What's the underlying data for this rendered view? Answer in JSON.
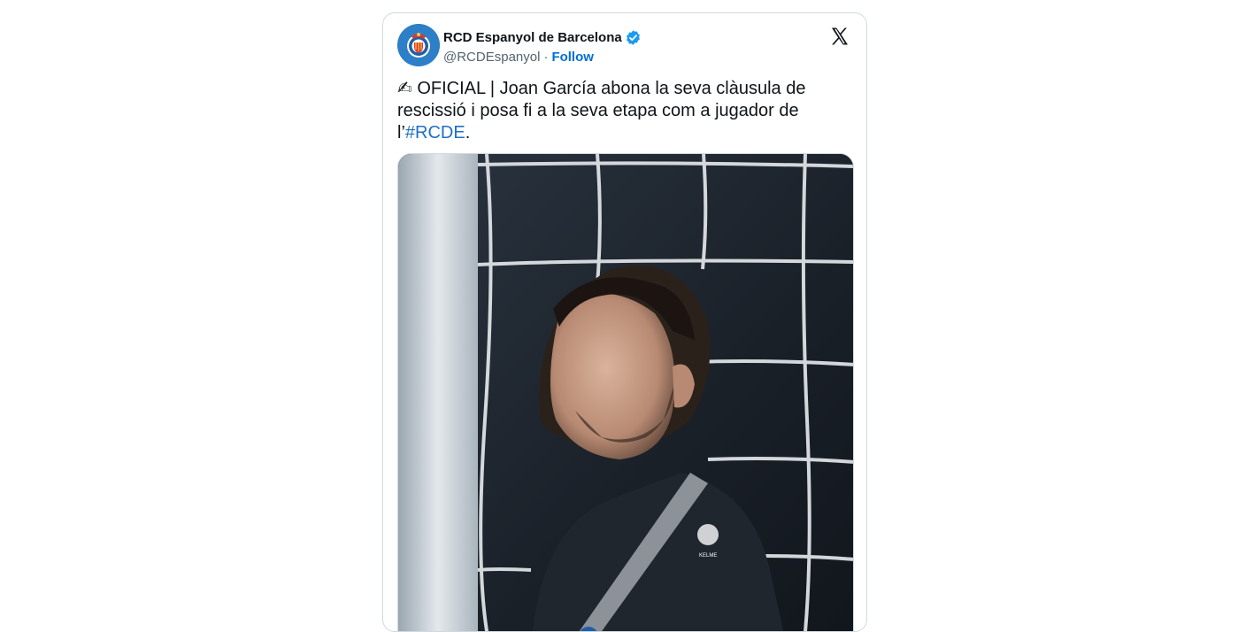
{
  "tweet": {
    "author": {
      "display_name": "RCD Espanyol de Barcelona",
      "handle": "@RCDEspanyol",
      "separator": "·",
      "follow_label": "Follow",
      "verified": true,
      "verified_color": "#1d9bf0"
    },
    "text": {
      "emoji": "✍",
      "body": " OFICIAL | Joan García abona la seva clàusula de rescissió i posa fi a la seva etapa com a jugador de l’",
      "hashtag": "#RCDE",
      "trailing": "."
    },
    "media": {
      "kind": "photo",
      "subject": "goalkeeper-in-front-of-net",
      "kit_brand": "KELME"
    }
  },
  "icons": {
    "platform_logo": "x-logo-icon",
    "verified": "verified-badge-icon"
  },
  "colors": {
    "link": "#006fd6",
    "hashtag": "#1d6fc7",
    "text": "#0f1419",
    "muted": "#536471",
    "border": "#cfd9de",
    "club_blue": "#2d7fc8"
  }
}
